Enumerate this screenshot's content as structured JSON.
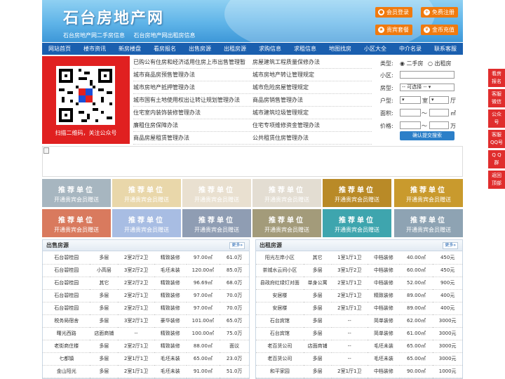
{
  "header": {
    "site_title": "石台房地产网",
    "sub_links": [
      "石台房地产网二手房信息",
      "石台房地产网出租房信息"
    ],
    "buttons": [
      {
        "label": "会员登录",
        "icon": "user-icon"
      },
      {
        "label": "免费注册",
        "icon": "register-icon"
      },
      {
        "label": "贵宾套餐",
        "icon": "vip-icon"
      },
      {
        "label": "金币充值",
        "icon": "coin-icon"
      }
    ]
  },
  "nav": [
    "网站首页",
    "楼市资讯",
    "新房楼盘",
    "看房报名",
    "出售房源",
    "出租房源",
    "求购信息",
    "求租信息",
    "地图找房",
    "小区大全",
    "中介名录",
    "联系客服"
  ],
  "qr": {
    "caption": "扫描二维码，关注公众号"
  },
  "policy_links": [
    [
      "已购公有住房和经济适用住房上市出售管理暂",
      "房屋建筑工程质量保修办法"
    ],
    [
      "城市商品房预售管理办法",
      "城市房地产转让管理规定"
    ],
    [
      "城市房地产抵押管理办法",
      "城市危险房屋管理规定"
    ],
    [
      "城市国有土地使用权出让转让规划管理办法",
      "商品房销售管理办法"
    ],
    [
      "住宅室内装饰装修管理办法",
      "城市建筑垃圾管理规定"
    ],
    [
      "廉租住房保障办法",
      "住宅专项维修资金管理办法"
    ],
    [
      "商品房屋租赁管理办法",
      "公共租赁住房管理办法"
    ]
  ],
  "search": {
    "type_label": "类型:",
    "type_options": [
      "二手房",
      "出租房"
    ],
    "community_label": "小区:",
    "house_label": "房型:",
    "house_select": "-- 可选择 --",
    "layout_label": "户型:",
    "room_unit": "室",
    "hall_unit": "厅",
    "area_label": "面积:",
    "area_unit": "㎡",
    "price_label": "价格:",
    "price_unit": "万",
    "range_sep": "～",
    "submit": "确认提交搜索"
  },
  "promo": {
    "title": "推荐单位",
    "subtitle": "开通贵宾会员赠送"
  },
  "promo_colors": [
    "#a7b6c0",
    "#e9d7aa",
    "#e9e0d0",
    "#e3ddd2",
    "#b98a27",
    "#c99a2d",
    "#d97a5e",
    "#a8bde3",
    "#8f9db3",
    "#a39b7a",
    "#3ea5ae",
    "#8ea3b3"
  ],
  "sale_panel": {
    "title": "出售房源",
    "more": "更多»",
    "rows": [
      [
        "石台碧桂园",
        "多层",
        "2室2厅2卫",
        "精致装修",
        "97.00㎡",
        "61.0万"
      ],
      [
        "石台碧桂园",
        "小高层",
        "3室2厅2卫",
        "毛坯未装",
        "120.00㎡",
        "85.0万"
      ],
      [
        "石台碧桂园",
        "其它",
        "2室2厅2卫",
        "精致装修",
        "96.69㎡",
        "68.0万"
      ],
      [
        "石台碧桂园",
        "多层",
        "2室2厅1卫",
        "精致装修",
        "97.00㎡",
        "70.0万"
      ],
      [
        "石台碧桂园",
        "多层",
        "2室2厅1卫",
        "精致装修",
        "97.00㎡",
        "70.0万"
      ],
      [
        "税务局宿舍",
        "多层",
        "3室2厅1卫",
        "豪华装修",
        "101.00㎡",
        "65.0万"
      ],
      [
        "曙光西路",
        "店面商铺",
        "--",
        "精致装修",
        "100.00㎡",
        "75.0万"
      ],
      [
        "老街商住楼",
        "多层",
        "2室2厅1卫",
        "精致装修",
        "88.00㎡",
        "面议"
      ],
      [
        "七都镇",
        "多层",
        "2室1厅1卫",
        "毛坯未装",
        "65.00㎡",
        "23.0万"
      ],
      [
        "金山阳光",
        "多层",
        "2室1厅1卫",
        "毛坯未装",
        "91.00㎡",
        "51.0万"
      ]
    ]
  },
  "rent_panel": {
    "title": "出租房源",
    "more": "更多»",
    "rows": [
      [
        "阳光左岸小区",
        "其它",
        "1室1厅1卫",
        "中档装修",
        "40.00㎡",
        "450元"
      ],
      [
        "茶城水云间小区",
        "多层",
        "3室1厅2卫",
        "中档装修",
        "60.00㎡",
        "450元"
      ],
      [
        "县政府红绿灯对面",
        "单身公寓",
        "2室1厅1卫",
        "中档装修",
        "52.00㎡",
        "900元"
      ],
      [
        "安居楼",
        "多层",
        "2室1厅1卫",
        "精致装修",
        "89.00㎡",
        "400元"
      ],
      [
        "安居楼",
        "多层",
        "2室1厅1卫",
        "中档装修",
        "89.00㎡",
        "400元"
      ],
      [
        "石台宾馆",
        "多层",
        "--",
        "简单装修",
        "62.00㎡",
        "3000元"
      ],
      [
        "石台宾馆",
        "多层",
        "--",
        "简单装修",
        "61.00㎡",
        "3000元"
      ],
      [
        "老百货公司",
        "店面商铺",
        "--",
        "毛坯未装",
        "65.00㎡",
        "3000元"
      ],
      [
        "老百货公司",
        "多层",
        "--",
        "毛坯未装",
        "65.00㎡",
        "3000元"
      ],
      [
        "和平家园",
        "多层",
        "2室1厅1卫",
        "中档装修",
        "90.00㎡",
        "1000元"
      ]
    ]
  },
  "side_float": [
    [
      "看房",
      "报名"
    ],
    [
      "客服",
      "微信"
    ],
    [
      "公众",
      "号"
    ],
    [
      "客服",
      "QQ号"
    ],
    [
      "Q Q",
      "群"
    ],
    [
      "返回",
      "顶部"
    ]
  ]
}
